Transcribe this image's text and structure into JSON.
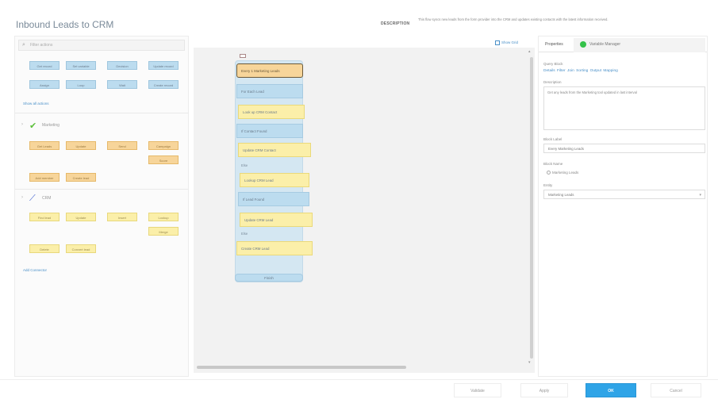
{
  "header": {
    "title": "Inbound Leads to CRM",
    "description_label": "DESCRIPTION",
    "description_text": "This flow syncs new leads from the form provider into the CRM and updates existing contacts with the latest information received."
  },
  "palette": {
    "search_placeholder": "Filter actions",
    "core": {
      "chips": [
        "Get record",
        "Set variable",
        "Decision",
        "Update record",
        "Assign",
        "Loop",
        "Wait",
        "Create record"
      ],
      "more_link": "Show all actions"
    },
    "marketing": {
      "name": "Marketing",
      "chips": [
        "Get Leads",
        "Update",
        "Send",
        "Campaign",
        "Score",
        "Add member",
        "Create lead"
      ]
    },
    "crm": {
      "name": "CRM",
      "chips": [
        "Find lead",
        "Update",
        "Insert",
        "Lookup",
        "Merge",
        "Delete",
        "Convert lead"
      ]
    },
    "add_connector_link": "Add Connector"
  },
  "canvas": {
    "show_grid_label": "Show Grid",
    "start_node": "Every 1 Marketing Leads",
    "nodes": [
      "For Each Lead",
      "Look up CRM Contact",
      "If Contact Found",
      "Update CRM Contact",
      "Lookup CRM Lead",
      "If Lead Found",
      "Update CRM Lead",
      "Create CRM Lead"
    ],
    "branch_labels": [
      "Else",
      "Else"
    ],
    "finish_label": "Finish"
  },
  "right_panel": {
    "tabs": [
      "Properties",
      "Variable Manager"
    ],
    "query_block_label": "Query Block",
    "query_links": "Details  Filter  Join  Sorting  Output Mapping",
    "description_label": "Description",
    "description_value": "Get any leads from the Marketing tool updated in last interval",
    "block_label_label": "Block Label",
    "block_label_value": "Every Marketing Leads",
    "block_name_label": "Block Name",
    "block_name_radio": "Marketing Leads",
    "entity_label": "Entity",
    "entity_value": "Marketing Leads"
  },
  "footer": {
    "validate": "Validate",
    "apply": "Apply",
    "ok": "OK",
    "cancel": "Cancel"
  },
  "colors": {
    "accent": "#2fa4e7",
    "action_blue": "#bcdcef",
    "action_orange": "#f7d59a",
    "action_yellow": "#fbefa9",
    "success_green": "#35c24a"
  }
}
